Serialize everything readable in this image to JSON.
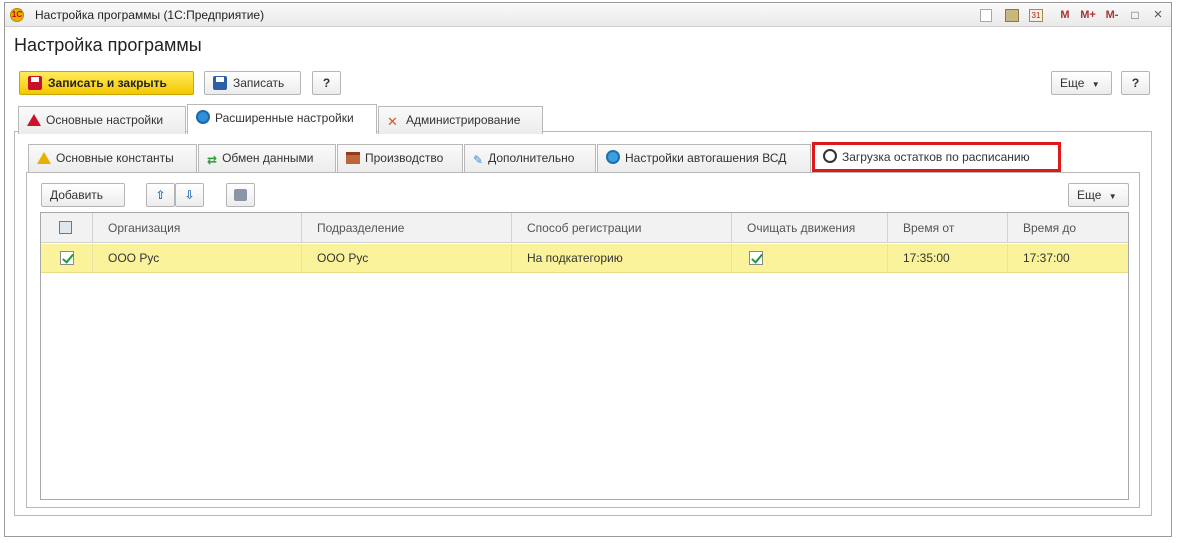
{
  "window": {
    "title": "Настройка программы  (1С:Предприятие)",
    "controls": [
      "M",
      "M+",
      "M-",
      "□",
      "×"
    ],
    "accent_color": "#f5c700"
  },
  "page_title": "Настройка программы",
  "toolbar": {
    "save_close_label": "Записать и закрыть",
    "save_label": "Записать",
    "help_label": "?",
    "more_label": "Еще",
    "more_help_label": "?"
  },
  "tabs_main": [
    {
      "label": "Основные настройки",
      "icon": "warning-red-icon"
    },
    {
      "label": "Расширенные настройки",
      "icon": "gear-blue-icon",
      "active": true
    },
    {
      "label": "Администрирование",
      "icon": "tools-icon"
    }
  ],
  "tabs_sub": [
    {
      "label": "Основные константы",
      "icon": "warning-yellow-icon"
    },
    {
      "label": "Обмен данными",
      "icon": "exchange-icon"
    },
    {
      "label": "Производство",
      "icon": "factory-icon"
    },
    {
      "label": "Дополнительно",
      "icon": "extra-icon"
    },
    {
      "label": "Настройки автогашения ВСД",
      "icon": "auto-icon"
    },
    {
      "label": "Загрузка остатков по расписанию",
      "icon": "clock-icon",
      "active": true,
      "highlight_color": "#e01818"
    }
  ],
  "grid_toolbar": {
    "add_label": "Добавить",
    "more_label": "Еще"
  },
  "grid": {
    "columns": [
      "",
      "Организация",
      "Подразделение",
      "Способ регистрации",
      "Очищать движения",
      "Время от",
      "Время до"
    ],
    "rows": [
      {
        "checked": true,
        "organization": "ООО Рус",
        "division": "ООО Рус",
        "registration": "На подкатегорию",
        "clear_movements": true,
        "time_from": "17:35:00",
        "time_to": "17:37:00"
      }
    ],
    "selected_row_color": "#fbf29c"
  }
}
